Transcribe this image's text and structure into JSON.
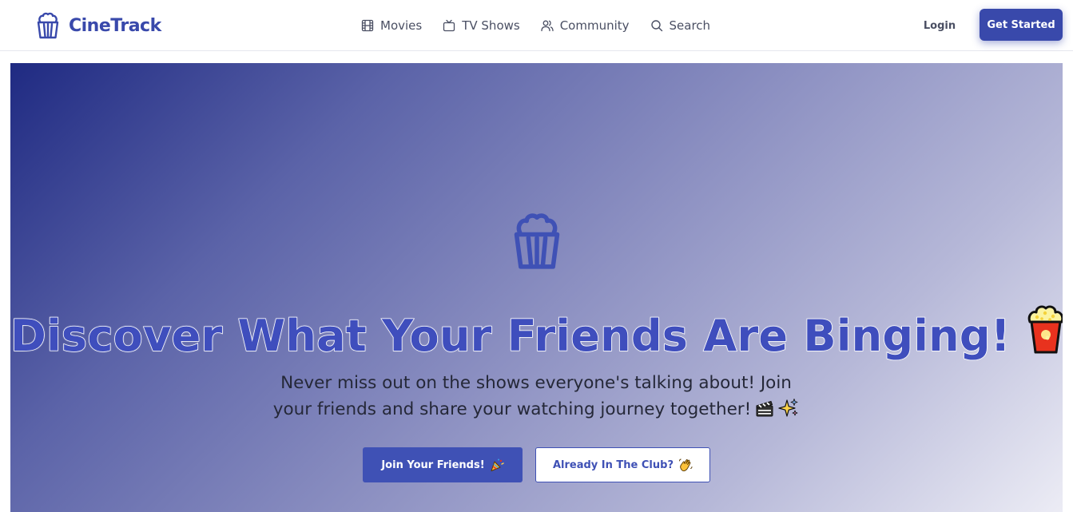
{
  "colors": {
    "brand": "#3949ab",
    "primary_button": "#3f51b5",
    "hero_gradient_start": "#1f2a82",
    "hero_gradient_end": "#ececf5",
    "nav_text": "#4a4f63"
  },
  "brand": {
    "icon": "popcorn-icon",
    "name": "CineTrack"
  },
  "nav": {
    "links": [
      {
        "label": "Movies",
        "icon": "film-icon"
      },
      {
        "label": "TV Shows",
        "icon": "tv-icon"
      },
      {
        "label": "Community",
        "icon": "users-icon"
      },
      {
        "label": "Search",
        "icon": "search-icon"
      }
    ],
    "login_label": "Login",
    "cta_label": "Get Started"
  },
  "hero": {
    "icon": "popcorn-icon",
    "title": "Discover What Your Friends Are Binging!",
    "title_emoji": "popcorn-emoji",
    "subtitle_line1": "Never miss out on the shows everyone's talking about! Join",
    "subtitle_line2": "your friends and share your watching journey together!",
    "subtitle_emojis": [
      "clapper-board-emoji",
      "sparkles-emoji"
    ],
    "primary_button": {
      "label": "Join Your Friends!",
      "emoji": "party-popper-emoji"
    },
    "secondary_button": {
      "label": "Already In The Club?",
      "emoji": "waving-hand-emoji"
    }
  }
}
